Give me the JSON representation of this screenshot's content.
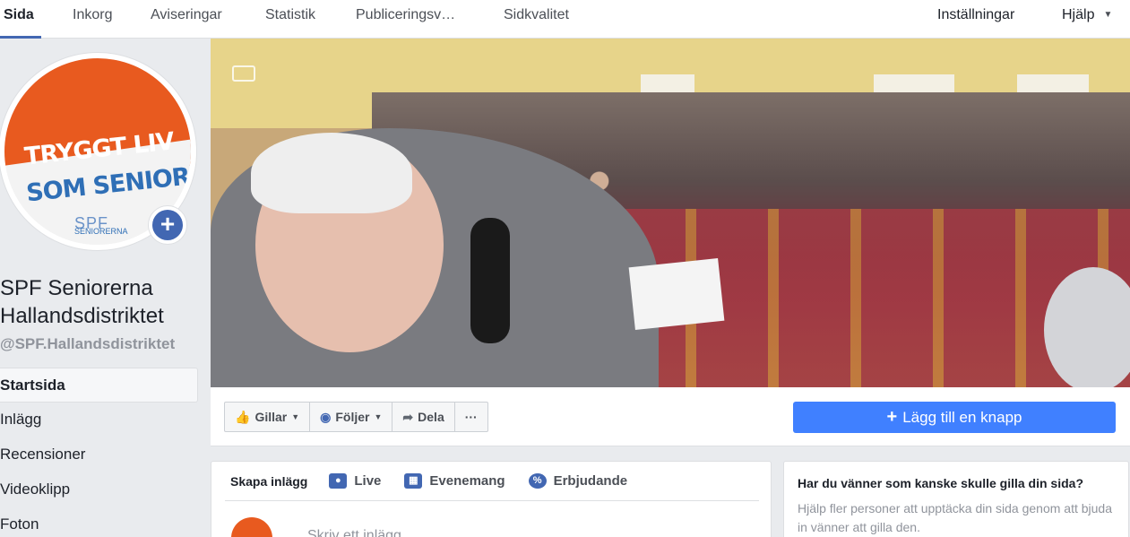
{
  "topnav": {
    "tabs": [
      {
        "label": "Sida",
        "active": true
      },
      {
        "label": "Inkorg",
        "active": false
      },
      {
        "label": "Aviseringar",
        "active": false
      },
      {
        "label": "Statistik",
        "active": false
      },
      {
        "label": "Publiceringsv…",
        "active": false
      },
      {
        "label": "Sidkvalitet",
        "active": false
      }
    ],
    "settings_label": "Inställningar",
    "help_label": "Hjälp"
  },
  "profile": {
    "logo_line1": "TRYGGT LIV",
    "logo_line2": "SOM SENIOR",
    "logo_brand": "SPF",
    "logo_sub": "SENIORERNA",
    "name": "SPF Seniorerna Hallandsdistriktet",
    "handle": "@SPF.Hallandsdistriktet",
    "accent_orange": "#e85a1f",
    "accent_blue": "#4267b2"
  },
  "left_nav": {
    "items": [
      {
        "label": "Startsida",
        "active": true
      },
      {
        "label": "Inlägg",
        "active": false
      },
      {
        "label": "Recensioner",
        "active": false
      },
      {
        "label": "Videoklipp",
        "active": false
      },
      {
        "label": "Foton",
        "active": false
      }
    ]
  },
  "actions": {
    "like_label": "Gillar",
    "follow_label": "Följer",
    "share_label": "Dela",
    "more_label": "···",
    "add_button_label": "Lägg till en knapp",
    "add_button_color": "#4080ff"
  },
  "composer": {
    "tabs": [
      "Skapa inlägg",
      "Live",
      "Evenemang",
      "Erbjudande"
    ],
    "placeholder": "Skriv ett inlägg..."
  },
  "invite_card": {
    "title": "Har du vänner som kanske skulle gilla din sida?",
    "body": "Hjälp fler personer att upptäcka din sida genom att bjuda in vänner att gilla den."
  }
}
